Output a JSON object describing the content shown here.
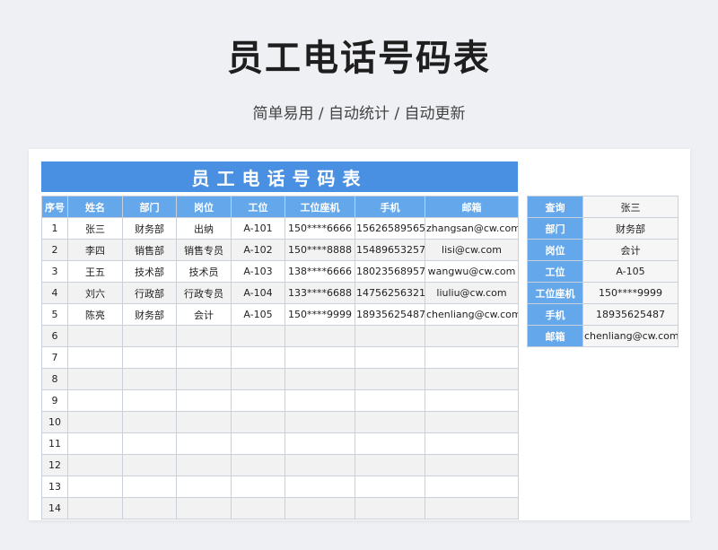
{
  "page": {
    "title": "员工电话号码表",
    "subtitle": "简单易用 / 自动统计 / 自动更新"
  },
  "sheet": {
    "banner": "员工电话号码表",
    "headers": [
      "序号",
      "姓名",
      "部门",
      "岗位",
      "工位",
      "工位座机",
      "手机",
      "邮箱"
    ],
    "rows": [
      [
        "1",
        "张三",
        "财务部",
        "出纳",
        "A-101",
        "150****6666",
        "15626589565",
        "zhangsan@cw.com"
      ],
      [
        "2",
        "李四",
        "销售部",
        "销售专员",
        "A-102",
        "150****8888",
        "15489653257",
        "lisi@cw.com"
      ],
      [
        "3",
        "王五",
        "技术部",
        "技术员",
        "A-103",
        "138****6666",
        "18023568957",
        "wangwu@cw.com"
      ],
      [
        "4",
        "刘六",
        "行政部",
        "行政专员",
        "A-104",
        "133****6688",
        "14756256321",
        "liuliu@cw.com"
      ],
      [
        "5",
        "陈亮",
        "财务部",
        "会计",
        "A-105",
        "150****9999",
        "18935625487",
        "chenliang@cw.com"
      ],
      [
        "6",
        "",
        "",
        "",
        "",
        "",
        "",
        ""
      ],
      [
        "7",
        "",
        "",
        "",
        "",
        "",
        "",
        ""
      ],
      [
        "8",
        "",
        "",
        "",
        "",
        "",
        "",
        ""
      ],
      [
        "9",
        "",
        "",
        "",
        "",
        "",
        "",
        ""
      ],
      [
        "10",
        "",
        "",
        "",
        "",
        "",
        "",
        ""
      ],
      [
        "11",
        "",
        "",
        "",
        "",
        "",
        "",
        ""
      ],
      [
        "12",
        "",
        "",
        "",
        "",
        "",
        "",
        ""
      ],
      [
        "13",
        "",
        "",
        "",
        "",
        "",
        "",
        ""
      ],
      [
        "14",
        "",
        "",
        "",
        "",
        "",
        "",
        ""
      ]
    ]
  },
  "lookup": {
    "rows": [
      {
        "label": "查询",
        "value": "张三"
      },
      {
        "label": "部门",
        "value": "财务部"
      },
      {
        "label": "岗位",
        "value": "会计"
      },
      {
        "label": "工位",
        "value": "A-105"
      },
      {
        "label": "工位座机",
        "value": "150****9999"
      },
      {
        "label": "手机",
        "value": "18935625487"
      },
      {
        "label": "邮箱",
        "value": "chenliang@cw.com"
      }
    ]
  },
  "colors": {
    "banner": "#4a90e2",
    "header": "#64a7ea",
    "alt_row": "#f2f2f2"
  }
}
